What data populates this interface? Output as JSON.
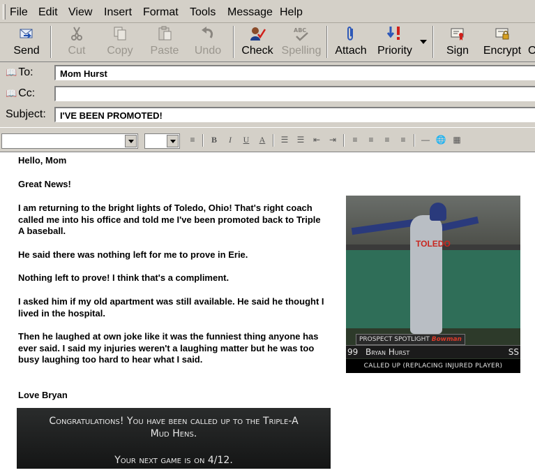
{
  "menu": [
    "File",
    "Edit",
    "View",
    "Insert",
    "Format",
    "Tools",
    "Message",
    "Help"
  ],
  "toolbar": {
    "send": "Send",
    "cut": "Cut",
    "copy": "Copy",
    "paste": "Paste",
    "undo": "Undo",
    "check": "Check",
    "spelling": "Spelling",
    "attach": "Attach",
    "priority": "Priority",
    "sign": "Sign",
    "encrypt": "Encrypt",
    "offline": "O"
  },
  "headers": {
    "to_label": "To:",
    "to_value": "Mom Hurst",
    "cc_label": "Cc:",
    "cc_value": "",
    "subject_label": "Subject:",
    "subject_value": "I'VE BEEN PROMOTED!"
  },
  "format": {
    "font": "",
    "size": "",
    "bold": "B",
    "italic": "I",
    "underline": "U",
    "color": "A"
  },
  "body": {
    "greeting": "Hello, Mom",
    "p1": "Great News!",
    "p2": "I am returning to the bright lights of Toledo, Ohio! That's right coach called me into his office and told me I've been promoted back to Triple A baseball.",
    "p3": "He said there was nothing left for me to prove in Erie.",
    "p4": "Nothing left to prove! I think that's a compliment.",
    "p5": "I asked him if my old apartment was still available. He said he thought I lived in the hospital.",
    "p6": "Then he laughed at own joke like it was the funniest thing anyone has ever said. I said my injuries weren't a laughing matter but he was too busy laughing too hard to hear what I said.",
    "signoff": "Love Bryan"
  },
  "image1": {
    "jersey": "TOLEDO",
    "prospect_label": "PROSPECT SPOTLIGHT",
    "brand": "Bowman",
    "number": "99",
    "player_name": "Bryan Hurst",
    "position": "SS",
    "status": "CALLED UP (REPLACING INJURED PLAYER)"
  },
  "image2": {
    "line1": "Congratulations! You have been called up to the Triple-A",
    "line2": "Mud Hens.",
    "line3": "Your next game is on 4/12."
  }
}
